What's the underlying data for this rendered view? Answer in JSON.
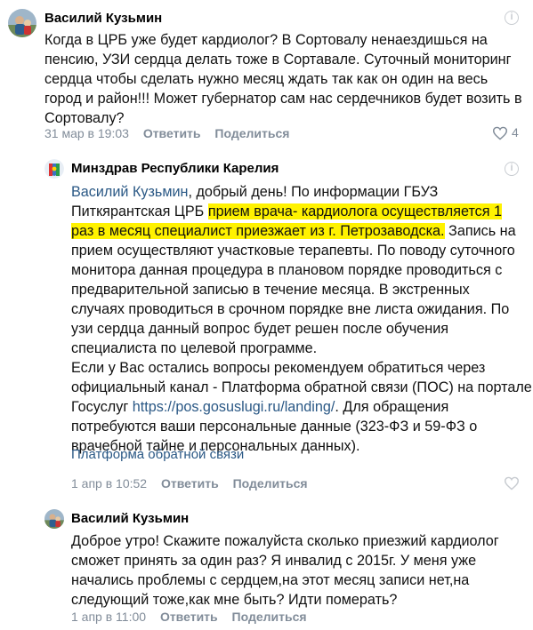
{
  "comments": [
    {
      "author": "Василий Кузьмин",
      "lines": [
        "Когда в ЦРБ уже будет кардиолог? В Сортовалу ненаездишься на",
        "пенсию, УЗИ сердца делать тоже в Сортавале. Суточный мониторинг",
        "сердца чтобы сделать нужно месяц ждать так как он один на весь",
        "город и район!!! Может губернатор сам нас сердечников будет возить в",
        "Сортовалу?"
      ],
      "date": "31 мар в 19:03",
      "reply": "Ответить",
      "share": "Поделиться",
      "likes": "4"
    },
    {
      "author": "Минздрав Республики Карелия",
      "mention": "Василий Кузьмин",
      "l1_rest": ", добрый день! По информации ГБУЗ",
      "l2a": "Питкярантская ЦРБ ",
      "l2b": "прием врача- кардиолога осуществляется 1",
      "l3a": "раз в месяц специалист приезжает из г. Петрозаводска.",
      "l3b": " Запись на",
      "lines": [
        "прием осуществляют участковые терапевты. По поводу суточного",
        "монитора данная процедура в плановом порядке проводиться с",
        "предварительной записью в течение месяца. В экстренных",
        "случаях проводиться в срочном порядке вне листа ожидания. По",
        "узи сердца данный вопрос будет решен после обучения",
        "специалиста по целевой программе.",
        "Если у Вас остались вопросы рекомендуем обратиться через",
        "официальный канал - Платформа обратной связи (ПОС) на портале"
      ],
      "l12a": "Госуслуг ",
      "link": "https://pos.gosuslugi.ru/landing/",
      "l12b": ". Для обращения",
      "lines2": [
        "потребуются ваши персональные данные (323-ФЗ и 59-ФЗ о",
        "врачебной тайне и персональных данных)."
      ],
      "attachment": "Платформа обратной связи",
      "date": "1 апр в 10:52",
      "reply": "Ответить",
      "share": "Поделиться"
    },
    {
      "author": "Василий Кузьмин",
      "lines": [
        "Доброе утро! Скажите пожалуйста сколько приезжий кардиолог",
        "сможет принять за один раз? Я инвалид с 2015г. У меня уже",
        "начались проблемы с сердцем,на этот месяц записи нет,на",
        "следующий тоже,как мне быть? Идти померать?"
      ],
      "date": "1 апр в 11:00",
      "reply": "Ответить",
      "share": "Поделиться"
    }
  ],
  "colors": {
    "link": "#2a5885",
    "meta": "#818c99",
    "highlight": "#fff200"
  },
  "icons": {
    "info": "info-circle-icon",
    "like": "heart-icon",
    "avatar_org": "coat-of-arms-icon",
    "avatar_user": "user-photo-icon"
  }
}
